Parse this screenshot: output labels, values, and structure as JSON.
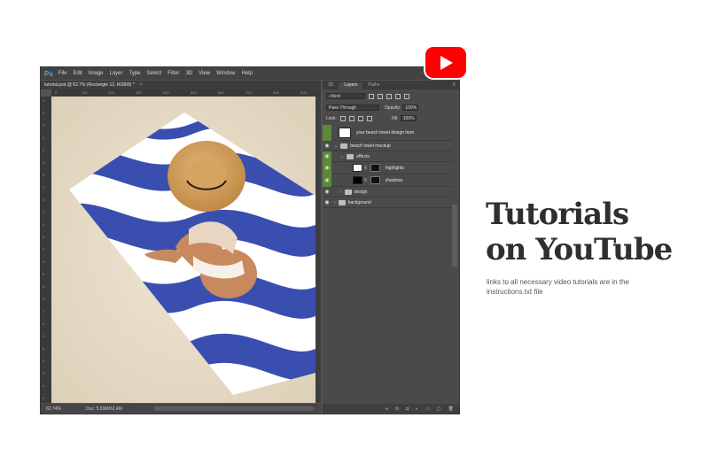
{
  "app": {
    "logo": "Ps",
    "menu": [
      "File",
      "Edit",
      "Image",
      "Layer",
      "Type",
      "Select",
      "Filter",
      "3D",
      "View",
      "Window",
      "Help"
    ],
    "window_controls": [
      "–",
      "□",
      "✕"
    ]
  },
  "document": {
    "tab_title": "tutorial.psd @ 62.7% (Rectangle 12, RGB/8) *",
    "ruler_h": [
      "0",
      "100",
      "200",
      "300",
      "400",
      "500",
      "600",
      "700",
      "800",
      "900"
    ],
    "ruler_v": [
      "1",
      "0",
      "0",
      "2",
      "0",
      "3",
      "0",
      "0",
      "4",
      "0",
      "0",
      "5",
      "0",
      "0",
      "6",
      "0",
      "0",
      "7",
      "0",
      "0",
      "8",
      "0",
      "9",
      "0",
      "0"
    ],
    "zoom": "62.74%",
    "doc_info": "Doc: 5.93M/62.4M"
  },
  "layers_panel": {
    "tabs": [
      "3D",
      "Layers",
      "Paths"
    ],
    "active_tab": "Layers",
    "filter_kind": "Kind",
    "blend_mode": "Pass Through",
    "opacity_label": "Opacity:",
    "opacity_value": "100%",
    "lock_label": "Lock:",
    "fill_label": "Fill:",
    "fill_value": "100%",
    "layers": [
      {
        "name": "your beach towel design here",
        "highlight": true
      },
      {
        "name": "beach towel mockup",
        "highlight": false
      },
      {
        "name": "effects",
        "highlight": true
      },
      {
        "name": "highlights",
        "highlight": true
      },
      {
        "name": "shadows",
        "highlight": true
      },
      {
        "name": "design",
        "highlight": false
      },
      {
        "name": "background",
        "highlight": false
      }
    ]
  },
  "headline": {
    "line1": "Tutorials",
    "line2": "on YouTube"
  },
  "subtext": "links to all necessary video tutorials are in the instructions.txt file",
  "colors": {
    "youtube_red": "#ff0000",
    "towel_blue": "#3a4eb0",
    "layer_green": "#5b8a38",
    "sand": "#e8ddc9"
  }
}
